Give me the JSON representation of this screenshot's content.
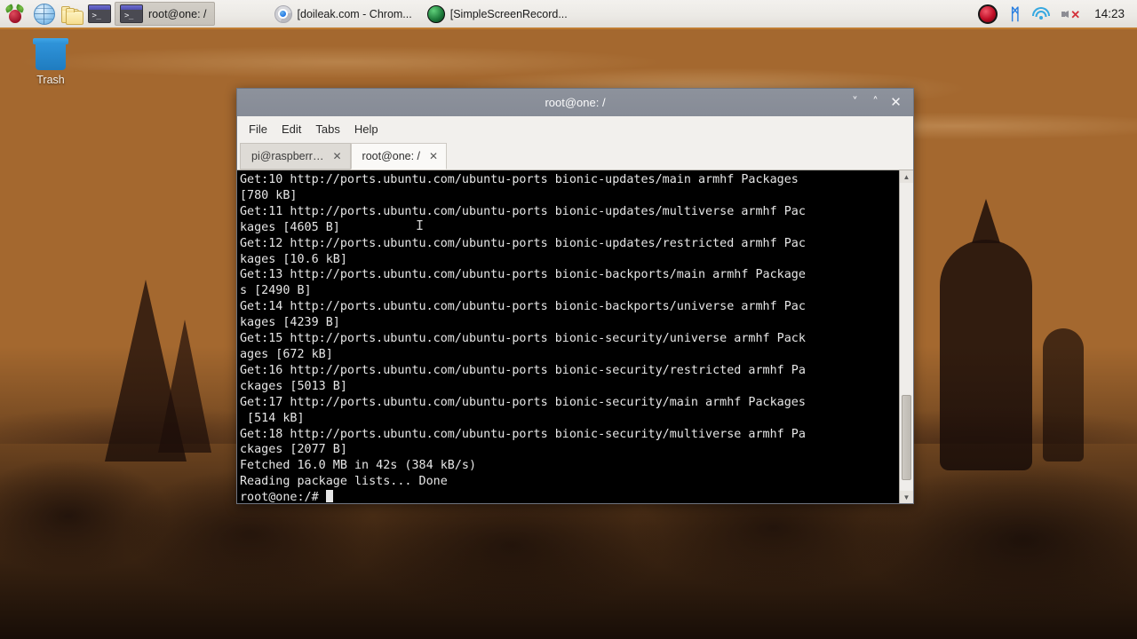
{
  "taskbar": {
    "launchers": [
      {
        "name": "menu-button",
        "icon": "raspberry-pi-logo-icon",
        "label": ""
      },
      {
        "name": "web-browser-launcher",
        "icon": "globe-icon",
        "label": ""
      },
      {
        "name": "file-manager-launcher",
        "icon": "folders-icon",
        "label": ""
      },
      {
        "name": "terminal-launcher",
        "icon": "terminal-icon",
        "label": ""
      }
    ],
    "tasks": [
      {
        "icon": "terminal-icon",
        "label": "root@one: /",
        "active": true
      },
      {
        "icon": "chrome-icon",
        "label": "[doileak.com - Chrom...",
        "active": false
      },
      {
        "icon": "green-globe-icon",
        "label": "[SimpleScreenRecord...",
        "active": false
      }
    ],
    "tray": [
      {
        "name": "record-indicator-icon",
        "label": ""
      },
      {
        "name": "bluetooth-icon",
        "label": "ᛗ"
      },
      {
        "name": "wifi-icon",
        "label": ""
      },
      {
        "name": "volume-muted-icon",
        "label": ""
      }
    ],
    "clock": "14:23"
  },
  "desktop": {
    "trash_label": "Trash"
  },
  "window": {
    "title": "root@one: /",
    "controls": {
      "minimize": "˅",
      "maximize": "˄",
      "close": "✕"
    },
    "menus": [
      "File",
      "Edit",
      "Tabs",
      "Help"
    ],
    "tabs": [
      {
        "title": "pi@raspberr…",
        "close": "✕",
        "active": false
      },
      {
        "title": "root@one: /",
        "close": "✕",
        "active": true
      }
    ],
    "terminal": {
      "lines": "Get:10 http://ports.ubuntu.com/ubuntu-ports bionic-updates/main armhf Packages\n[780 kB]\nGet:11 http://ports.ubuntu.com/ubuntu-ports bionic-updates/multiverse armhf Pac\nkages [4605 B]\nGet:12 http://ports.ubuntu.com/ubuntu-ports bionic-updates/restricted armhf Pac\nkages [10.6 kB]\nGet:13 http://ports.ubuntu.com/ubuntu-ports bionic-backports/main armhf Package\ns [2490 B]\nGet:14 http://ports.ubuntu.com/ubuntu-ports bionic-backports/universe armhf Pac\nkages [4239 B]\nGet:15 http://ports.ubuntu.com/ubuntu-ports bionic-security/universe armhf Pack\nages [672 kB]\nGet:16 http://ports.ubuntu.com/ubuntu-ports bionic-security/restricted armhf Pa\nckages [5013 B]\nGet:17 http://ports.ubuntu.com/ubuntu-ports bionic-security/main armhf Packages\n [514 kB]\nGet:18 http://ports.ubuntu.com/ubuntu-ports bionic-security/multiverse armhf Pa\nckages [2077 B]\nFetched 16.0 MB in 42s (384 kB/s)\nReading package lists... Done\n",
      "prompt": "root@one:/#",
      "mouse_caret": "I"
    },
    "scrollbar": {
      "up": "▲",
      "down": "▼"
    }
  },
  "colors": {
    "taskbar_bg": "#efedea",
    "taskbar_accent": "#c07c30",
    "titlebar_bg": "#888d97",
    "terminal_bg": "#000000",
    "terminal_fg": "#e6e6e6",
    "trash_blue": "#2e92d8"
  }
}
